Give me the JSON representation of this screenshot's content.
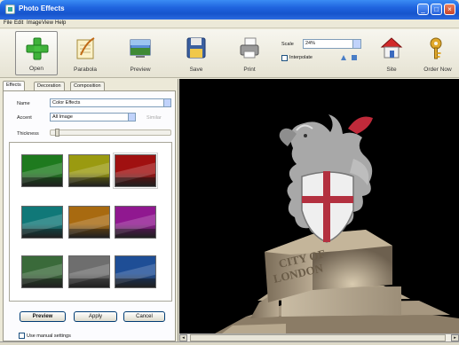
{
  "window": {
    "title": "Photo Effects"
  },
  "menu": [
    "File",
    "Edit",
    "Image",
    "View",
    "Help"
  ],
  "toolbar": {
    "buttons": [
      {
        "id": "open",
        "label": "Open",
        "icon": "plus-icon"
      },
      {
        "id": "parabola",
        "label": "Parabola",
        "icon": "notepad-icon"
      },
      {
        "id": "preview",
        "label": "Preview",
        "icon": "picture-icon"
      },
      {
        "id": "save",
        "label": "Save",
        "icon": "floppy-icon"
      },
      {
        "id": "print",
        "label": "Print",
        "icon": "printer-icon"
      },
      {
        "id": "site",
        "label": "Site",
        "icon": "house-icon"
      },
      {
        "id": "order",
        "label": "Order Now",
        "icon": "key-icon"
      }
    ],
    "scale_label": "Scale",
    "scale_value": "24%",
    "interpolate_label": "Interpolate"
  },
  "tabs": [
    "Effects",
    "Decoration",
    "Composition"
  ],
  "effects": {
    "name_label": "Name",
    "name_value": "Color Effects",
    "accent_label": "Accent",
    "accent_value": "All Image",
    "accent_extra": "Similar",
    "thickness_label": "Thickness",
    "thickness_value": 0.03,
    "thumbnails": [
      {
        "color": "#1e7a1e",
        "selected": false
      },
      {
        "color": "#9a9a10",
        "selected": false
      },
      {
        "color": "#a01010",
        "selected": true
      },
      {
        "color": "#107878",
        "selected": false
      },
      {
        "color": "#a86a10",
        "selected": false
      },
      {
        "color": "#901890",
        "selected": false
      },
      {
        "color": "#3a6a3a",
        "selected": false
      },
      {
        "color": "#6e6e6e",
        "selected": false
      },
      {
        "color": "#1e4e96",
        "selected": false
      }
    ]
  },
  "buttons": {
    "preview": "Preview",
    "apply": "Apply",
    "cancel": "Cancel"
  },
  "manual_settings_label": "Use manual settings",
  "photo": {
    "plinth_line1": "CITY OF",
    "plinth_line2": "LONDON"
  }
}
